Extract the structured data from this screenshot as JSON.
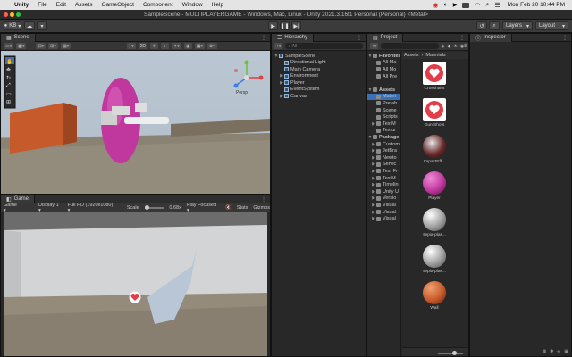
{
  "menubar": {
    "items": [
      "Unity",
      "File",
      "Edit",
      "Assets",
      "GameObject",
      "Component",
      "Window",
      "Help"
    ],
    "clock": "Mon Feb 20  10:44 PM"
  },
  "titlebar": {
    "title": "SampleScene - MULTIPLAYERGAME - Windows, Mac, Linux - Unity 2021.3.16f1 Personal (Personal) <Metal>"
  },
  "toolbar": {
    "account": "KB",
    "layers": "Layers",
    "layout": "Layout"
  },
  "scene": {
    "tab": "Scene",
    "persp": "Persp"
  },
  "game": {
    "tab": "Game",
    "mode": "Game",
    "display": "Display 1",
    "resolution": "Full HD (1920x1080)",
    "scale_label": "Scale",
    "scale_value": "0.68x",
    "play_focused": "Play Focused",
    "stats": "Stats",
    "gizmos": "Gizmos"
  },
  "hierarchy": {
    "tab": "Hierarchy",
    "search": "All",
    "items": [
      {
        "label": "SampleScene",
        "depth": 0,
        "icon": "scene-icon",
        "arrow": "▼"
      },
      {
        "label": "Directional Light",
        "depth": 1,
        "icon": "gameobject-icon",
        "arrow": ""
      },
      {
        "label": "Main Camera",
        "depth": 1,
        "icon": "gameobject-icon",
        "arrow": ""
      },
      {
        "label": "Environment",
        "depth": 1,
        "icon": "gameobject-icon",
        "arrow": "▶"
      },
      {
        "label": "Player",
        "depth": 1,
        "icon": "gameobject-icon",
        "arrow": "▶"
      },
      {
        "label": "EventSystem",
        "depth": 1,
        "icon": "gameobject-icon",
        "arrow": ""
      },
      {
        "label": "Canvas",
        "depth": 1,
        "icon": "gameobject-icon",
        "arrow": "▶"
      }
    ]
  },
  "project": {
    "tab": "Project",
    "count": "8",
    "breadcrumb": [
      "Assets",
      "Materials"
    ],
    "tree": [
      {
        "label": "Favorites",
        "depth": 0,
        "arrow": "▼",
        "bold": true,
        "icon": "star-icon"
      },
      {
        "label": "All Ma",
        "depth": 1,
        "arrow": "",
        "icon": "search-icon"
      },
      {
        "label": "All Mo",
        "depth": 1,
        "arrow": "",
        "icon": "search-icon"
      },
      {
        "label": "All Pre",
        "depth": 1,
        "arrow": "",
        "icon": "search-icon"
      },
      {
        "label": "",
        "depth": 0,
        "arrow": "",
        "icon": ""
      },
      {
        "label": "Assets",
        "depth": 0,
        "arrow": "▼",
        "bold": true,
        "icon": "folder-icon"
      },
      {
        "label": "Materi",
        "depth": 1,
        "arrow": "",
        "icon": "folder-icon",
        "selected": true
      },
      {
        "label": "Prefab",
        "depth": 1,
        "arrow": "",
        "icon": "folder-icon"
      },
      {
        "label": "Scene",
        "depth": 1,
        "arrow": "",
        "icon": "folder-icon"
      },
      {
        "label": "Scripts",
        "depth": 1,
        "arrow": "",
        "icon": "folder-icon"
      },
      {
        "label": "TextM",
        "depth": 1,
        "arrow": "▶",
        "icon": "folder-icon"
      },
      {
        "label": "Textur",
        "depth": 1,
        "arrow": "",
        "icon": "folder-icon"
      },
      {
        "label": "Package",
        "depth": 0,
        "arrow": "▼",
        "bold": true,
        "icon": "folder-icon"
      },
      {
        "label": "Custom",
        "depth": 1,
        "arrow": "▶",
        "icon": "folder-icon"
      },
      {
        "label": "JetBra",
        "depth": 1,
        "arrow": "▶",
        "icon": "folder-icon"
      },
      {
        "label": "Newto",
        "depth": 1,
        "arrow": "▶",
        "icon": "folder-icon"
      },
      {
        "label": "Servic",
        "depth": 1,
        "arrow": "▶",
        "icon": "folder-icon"
      },
      {
        "label": "Test Fr",
        "depth": 1,
        "arrow": "▶",
        "icon": "folder-icon"
      },
      {
        "label": "TextM",
        "depth": 1,
        "arrow": "▶",
        "icon": "folder-icon"
      },
      {
        "label": "Timelin",
        "depth": 1,
        "arrow": "▶",
        "icon": "folder-icon"
      },
      {
        "label": "Unity U",
        "depth": 1,
        "arrow": "▶",
        "icon": "folder-icon"
      },
      {
        "label": "Versio",
        "depth": 1,
        "arrow": "▶",
        "icon": "folder-icon"
      },
      {
        "label": "Visual",
        "depth": 1,
        "arrow": "▶",
        "icon": "folder-icon"
      },
      {
        "label": "Visual",
        "depth": 1,
        "arrow": "▶",
        "icon": "folder-icon"
      },
      {
        "label": "Visual",
        "depth": 1,
        "arrow": "▶",
        "icon": "folder-icon"
      }
    ],
    "assets": [
      {
        "label": "Crosshairs",
        "kind": "heart"
      },
      {
        "label": "Gun Shots",
        "kind": "heart"
      },
      {
        "label": "ImpactEff...",
        "kind": "impact"
      },
      {
        "label": "Player",
        "kind": "sphere-magenta"
      },
      {
        "label": "sepia-plas...",
        "kind": "sphere-grey"
      },
      {
        "label": "sepia-plas...",
        "kind": "sphere-grey"
      },
      {
        "label": "Wall",
        "kind": "sphere-orange"
      }
    ]
  },
  "inspector": {
    "tab": "Inspector"
  },
  "colors": {
    "accent": "#3a6fb5",
    "capsule": "#c0389d",
    "wall": "#c65a2a",
    "heart": "#e23d4a"
  }
}
